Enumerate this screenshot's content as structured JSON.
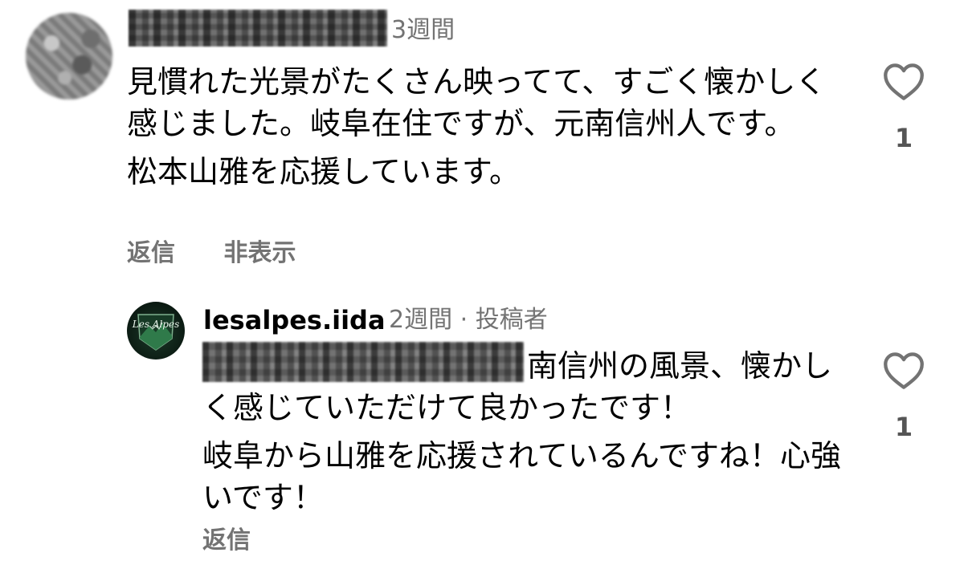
{
  "comment": {
    "time": "3週間",
    "text_paragraph_1": "見慣れた光景がたくさん映ってて、すごく懐かしく感じました。岐阜在住ですが、元南信州人です。",
    "text_paragraph_2": "松本山雅を応援しています。",
    "reply_label": "返信",
    "hide_label": "非表示",
    "like_count": "1",
    "like_icon": "heart-outline-icon"
  },
  "reply": {
    "username": "lesalpes.iida",
    "meta": "2週間 · 投稿者",
    "avatar_logo_text": "Les Alpes",
    "text_paragraph_1": "南信州の風景、懐かしく感じていただけて良かったです！",
    "text_paragraph_2": "岐阜から山雅を応援されているんですね！心強いです！",
    "reply_label": "返信",
    "like_count": "1",
    "like_icon": "heart-outline-icon"
  },
  "colors": {
    "secondary_text": "#737373",
    "primary_text": "#000000",
    "avatar_green": "#2f7a4a"
  }
}
